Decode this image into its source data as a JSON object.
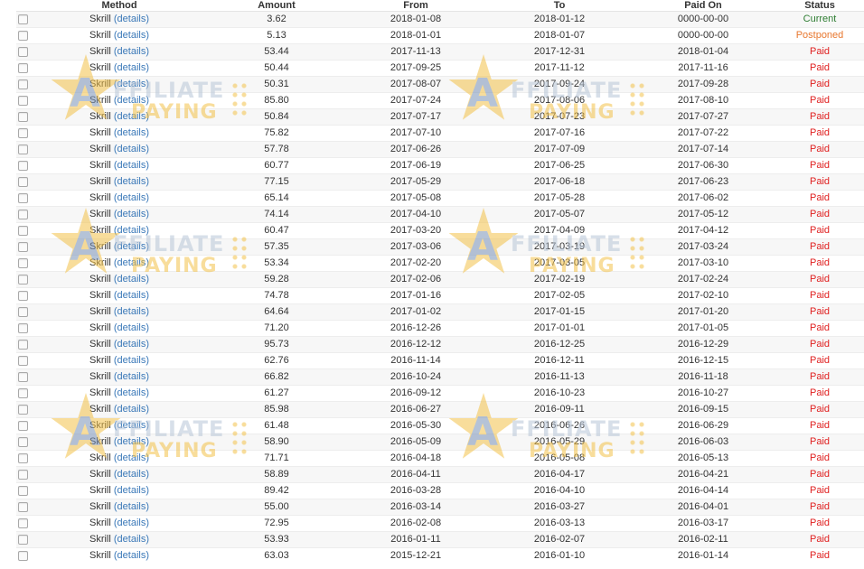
{
  "headers": {
    "method": "Method",
    "amount": "Amount",
    "from": "From",
    "to": "To",
    "paid_on": "Paid On",
    "status": "Status"
  },
  "watermark": {
    "letter": "A",
    "line1": "FFILIATE",
    "line2": "PAYING"
  },
  "colors": {
    "paid": "#e02020",
    "current": "#2e7d32",
    "postponed": "#e8772e",
    "link": "#3a78b8"
  },
  "rows": [
    {
      "method": "Skrill",
      "details": "(details)",
      "amount": "3.62",
      "from": "2018-01-08",
      "to": "2018-01-12",
      "paid_on": "0000-00-00",
      "status": "Current",
      "status_type": "current"
    },
    {
      "method": "Skrill",
      "details": "(details)",
      "amount": "5.13",
      "from": "2018-01-01",
      "to": "2018-01-07",
      "paid_on": "0000-00-00",
      "status": "Postponed",
      "status_type": "postponed"
    },
    {
      "method": "Skrill",
      "details": "(details)",
      "amount": "53.44",
      "from": "2017-11-13",
      "to": "2017-12-31",
      "paid_on": "2018-01-04",
      "status": "Paid",
      "status_type": "paid"
    },
    {
      "method": "Skrill",
      "details": "(details)",
      "amount": "50.44",
      "from": "2017-09-25",
      "to": "2017-11-12",
      "paid_on": "2017-11-16",
      "status": "Paid",
      "status_type": "paid"
    },
    {
      "method": "Skrill",
      "details": "(details)",
      "amount": "50.31",
      "from": "2017-08-07",
      "to": "2017-09-24",
      "paid_on": "2017-09-28",
      "status": "Paid",
      "status_type": "paid"
    },
    {
      "method": "Skrill",
      "details": "(details)",
      "amount": "85.80",
      "from": "2017-07-24",
      "to": "2017-08-06",
      "paid_on": "2017-08-10",
      "status": "Paid",
      "status_type": "paid"
    },
    {
      "method": "Skrill",
      "details": "(details)",
      "amount": "50.84",
      "from": "2017-07-17",
      "to": "2017-07-23",
      "paid_on": "2017-07-27",
      "status": "Paid",
      "status_type": "paid"
    },
    {
      "method": "Skrill",
      "details": "(details)",
      "amount": "75.82",
      "from": "2017-07-10",
      "to": "2017-07-16",
      "paid_on": "2017-07-22",
      "status": "Paid",
      "status_type": "paid"
    },
    {
      "method": "Skrill",
      "details": "(details)",
      "amount": "57.78",
      "from": "2017-06-26",
      "to": "2017-07-09",
      "paid_on": "2017-07-14",
      "status": "Paid",
      "status_type": "paid"
    },
    {
      "method": "Skrill",
      "details": "(details)",
      "amount": "60.77",
      "from": "2017-06-19",
      "to": "2017-06-25",
      "paid_on": "2017-06-30",
      "status": "Paid",
      "status_type": "paid"
    },
    {
      "method": "Skrill",
      "details": "(details)",
      "amount": "77.15",
      "from": "2017-05-29",
      "to": "2017-06-18",
      "paid_on": "2017-06-23",
      "status": "Paid",
      "status_type": "paid"
    },
    {
      "method": "Skrill",
      "details": "(details)",
      "amount": "65.14",
      "from": "2017-05-08",
      "to": "2017-05-28",
      "paid_on": "2017-06-02",
      "status": "Paid",
      "status_type": "paid"
    },
    {
      "method": "Skrill",
      "details": "(details)",
      "amount": "74.14",
      "from": "2017-04-10",
      "to": "2017-05-07",
      "paid_on": "2017-05-12",
      "status": "Paid",
      "status_type": "paid"
    },
    {
      "method": "Skrill",
      "details": "(details)",
      "amount": "60.47",
      "from": "2017-03-20",
      "to": "2017-04-09",
      "paid_on": "2017-04-12",
      "status": "Paid",
      "status_type": "paid"
    },
    {
      "method": "Skrill",
      "details": "(details)",
      "amount": "57.35",
      "from": "2017-03-06",
      "to": "2017-03-19",
      "paid_on": "2017-03-24",
      "status": "Paid",
      "status_type": "paid"
    },
    {
      "method": "Skrill",
      "details": "(details)",
      "amount": "53.34",
      "from": "2017-02-20",
      "to": "2017-03-05",
      "paid_on": "2017-03-10",
      "status": "Paid",
      "status_type": "paid"
    },
    {
      "method": "Skrill",
      "details": "(details)",
      "amount": "59.28",
      "from": "2017-02-06",
      "to": "2017-02-19",
      "paid_on": "2017-02-24",
      "status": "Paid",
      "status_type": "paid"
    },
    {
      "method": "Skrill",
      "details": "(details)",
      "amount": "74.78",
      "from": "2017-01-16",
      "to": "2017-02-05",
      "paid_on": "2017-02-10",
      "status": "Paid",
      "status_type": "paid"
    },
    {
      "method": "Skrill",
      "details": "(details)",
      "amount": "64.64",
      "from": "2017-01-02",
      "to": "2017-01-15",
      "paid_on": "2017-01-20",
      "status": "Paid",
      "status_type": "paid"
    },
    {
      "method": "Skrill",
      "details": "(details)",
      "amount": "71.20",
      "from": "2016-12-26",
      "to": "2017-01-01",
      "paid_on": "2017-01-05",
      "status": "Paid",
      "status_type": "paid"
    },
    {
      "method": "Skrill",
      "details": "(details)",
      "amount": "95.73",
      "from": "2016-12-12",
      "to": "2016-12-25",
      "paid_on": "2016-12-29",
      "status": "Paid",
      "status_type": "paid"
    },
    {
      "method": "Skrill",
      "details": "(details)",
      "amount": "62.76",
      "from": "2016-11-14",
      "to": "2016-12-11",
      "paid_on": "2016-12-15",
      "status": "Paid",
      "status_type": "paid"
    },
    {
      "method": "Skrill",
      "details": "(details)",
      "amount": "66.82",
      "from": "2016-10-24",
      "to": "2016-11-13",
      "paid_on": "2016-11-18",
      "status": "Paid",
      "status_type": "paid"
    },
    {
      "method": "Skrill",
      "details": "(details)",
      "amount": "61.27",
      "from": "2016-09-12",
      "to": "2016-10-23",
      "paid_on": "2016-10-27",
      "status": "Paid",
      "status_type": "paid"
    },
    {
      "method": "Skrill",
      "details": "(details)",
      "amount": "85.98",
      "from": "2016-06-27",
      "to": "2016-09-11",
      "paid_on": "2016-09-15",
      "status": "Paid",
      "status_type": "paid"
    },
    {
      "method": "Skrill",
      "details": "(details)",
      "amount": "61.48",
      "from": "2016-05-30",
      "to": "2016-06-26",
      "paid_on": "2016-06-29",
      "status": "Paid",
      "status_type": "paid"
    },
    {
      "method": "Skrill",
      "details": "(details)",
      "amount": "58.90",
      "from": "2016-05-09",
      "to": "2016-05-29",
      "paid_on": "2016-06-03",
      "status": "Paid",
      "status_type": "paid"
    },
    {
      "method": "Skrill",
      "details": "(details)",
      "amount": "71.71",
      "from": "2016-04-18",
      "to": "2016-05-08",
      "paid_on": "2016-05-13",
      "status": "Paid",
      "status_type": "paid"
    },
    {
      "method": "Skrill",
      "details": "(details)",
      "amount": "58.89",
      "from": "2016-04-11",
      "to": "2016-04-17",
      "paid_on": "2016-04-21",
      "status": "Paid",
      "status_type": "paid"
    },
    {
      "method": "Skrill",
      "details": "(details)",
      "amount": "89.42",
      "from": "2016-03-28",
      "to": "2016-04-10",
      "paid_on": "2016-04-14",
      "status": "Paid",
      "status_type": "paid"
    },
    {
      "method": "Skrill",
      "details": "(details)",
      "amount": "55.00",
      "from": "2016-03-14",
      "to": "2016-03-27",
      "paid_on": "2016-04-01",
      "status": "Paid",
      "status_type": "paid"
    },
    {
      "method": "Skrill",
      "details": "(details)",
      "amount": "72.95",
      "from": "2016-02-08",
      "to": "2016-03-13",
      "paid_on": "2016-03-17",
      "status": "Paid",
      "status_type": "paid"
    },
    {
      "method": "Skrill",
      "details": "(details)",
      "amount": "53.93",
      "from": "2016-01-11",
      "to": "2016-02-07",
      "paid_on": "2016-02-11",
      "status": "Paid",
      "status_type": "paid"
    },
    {
      "method": "Skrill",
      "details": "(details)",
      "amount": "63.03",
      "from": "2015-12-21",
      "to": "2016-01-10",
      "paid_on": "2016-01-14",
      "status": "Paid",
      "status_type": "paid"
    }
  ]
}
